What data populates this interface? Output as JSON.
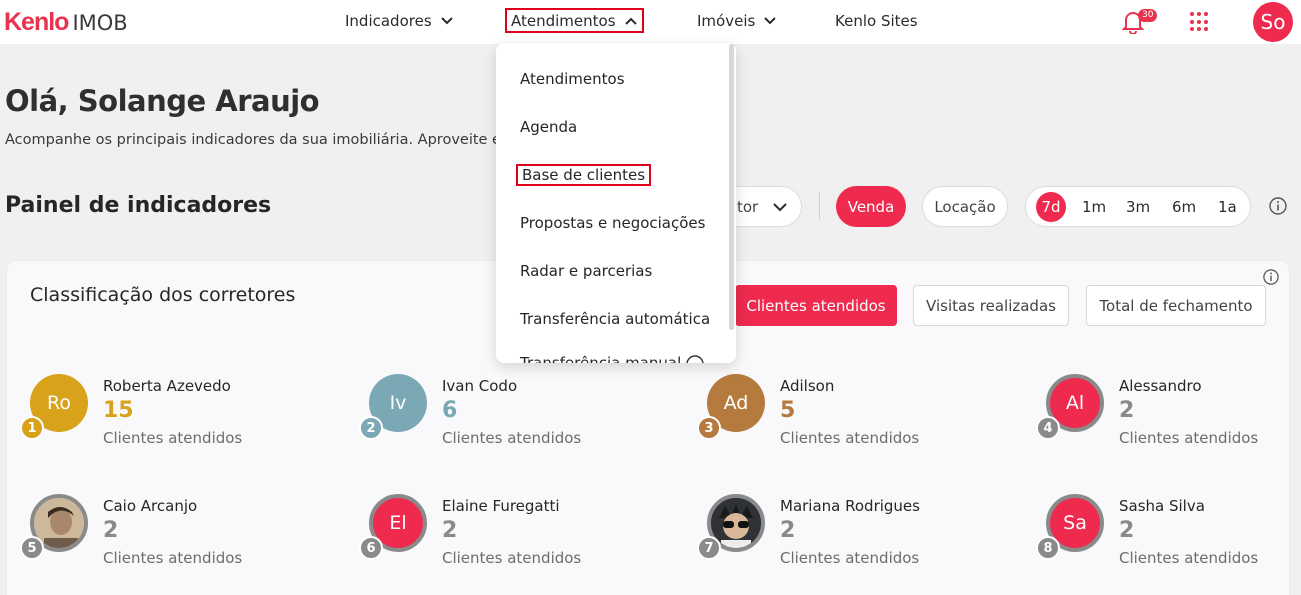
{
  "header": {
    "logo_kenlo": "Kenlo",
    "logo_imob": "IMOB",
    "nav": [
      {
        "label": "Indicadores"
      },
      {
        "label": "Atendimentos"
      },
      {
        "label": "Imóveis"
      },
      {
        "label": "Kenlo Sites"
      }
    ],
    "notifications_count": "30",
    "user_initials": "So"
  },
  "greeting": "Olá, Solange Araujo",
  "subtitle": "Acompanhe os principais indicadores da sua imobiliária. Aproveite e co                                     s negócios.",
  "panel": {
    "title": "Painel de indicadores",
    "corretor_label": "tor",
    "venda": "Venda",
    "locacao": "Locação",
    "periods": [
      "7d",
      "1m",
      "3m",
      "6m",
      "1a"
    ]
  },
  "card": {
    "title": "Classificação dos corretores",
    "metrics": [
      "Clientes atendidos",
      "Visitas realizadas",
      "Total de fechamento"
    ]
  },
  "ranking": [
    {
      "initials": "Ro",
      "pos": "1",
      "name": "Roberta Azevedo",
      "value": "15",
      "label": "Clientes atendidos",
      "color": "#d8a31a"
    },
    {
      "initials": "Iv",
      "pos": "2",
      "name": "Ivan Codo",
      "value": "6",
      "label": "Clientes atendidos",
      "color": "#7aa8b4"
    },
    {
      "initials": "Ad",
      "pos": "3",
      "name": "Adilson",
      "value": "5",
      "label": "Clientes atendidos",
      "color": "#b57a3e"
    },
    {
      "initials": "Al",
      "pos": "4",
      "name": "Alessandro",
      "value": "2",
      "label": "Clientes atendidos",
      "color": "#ee2b4f"
    },
    {
      "initials": "",
      "pos": "5",
      "name": "Caio Arcanjo",
      "value": "2",
      "label": "Clientes atendidos",
      "color": "#8a8a8a"
    },
    {
      "initials": "El",
      "pos": "6",
      "name": "Elaine Furegatti",
      "value": "2",
      "label": "Clientes atendidos",
      "color": "#ee2b4f"
    },
    {
      "initials": "",
      "pos": "7",
      "name": "Mariana Rodrigues",
      "value": "2",
      "label": "Clientes atendidos",
      "color": "#8a8a8a"
    },
    {
      "initials": "Sa",
      "pos": "8",
      "name": "Sasha Silva",
      "value": "2",
      "label": "Clientes atendidos",
      "color": "#ee2b4f"
    }
  ],
  "dropdown": {
    "items": [
      "Atendimentos",
      "Agenda",
      "Base de clientes",
      "Propostas e negociações",
      "Radar e parcerias",
      "Transferência automática",
      "Transferência manual"
    ]
  },
  "colors": {
    "brand": "#ee2b4f",
    "highlight_border": "#e0001b"
  }
}
